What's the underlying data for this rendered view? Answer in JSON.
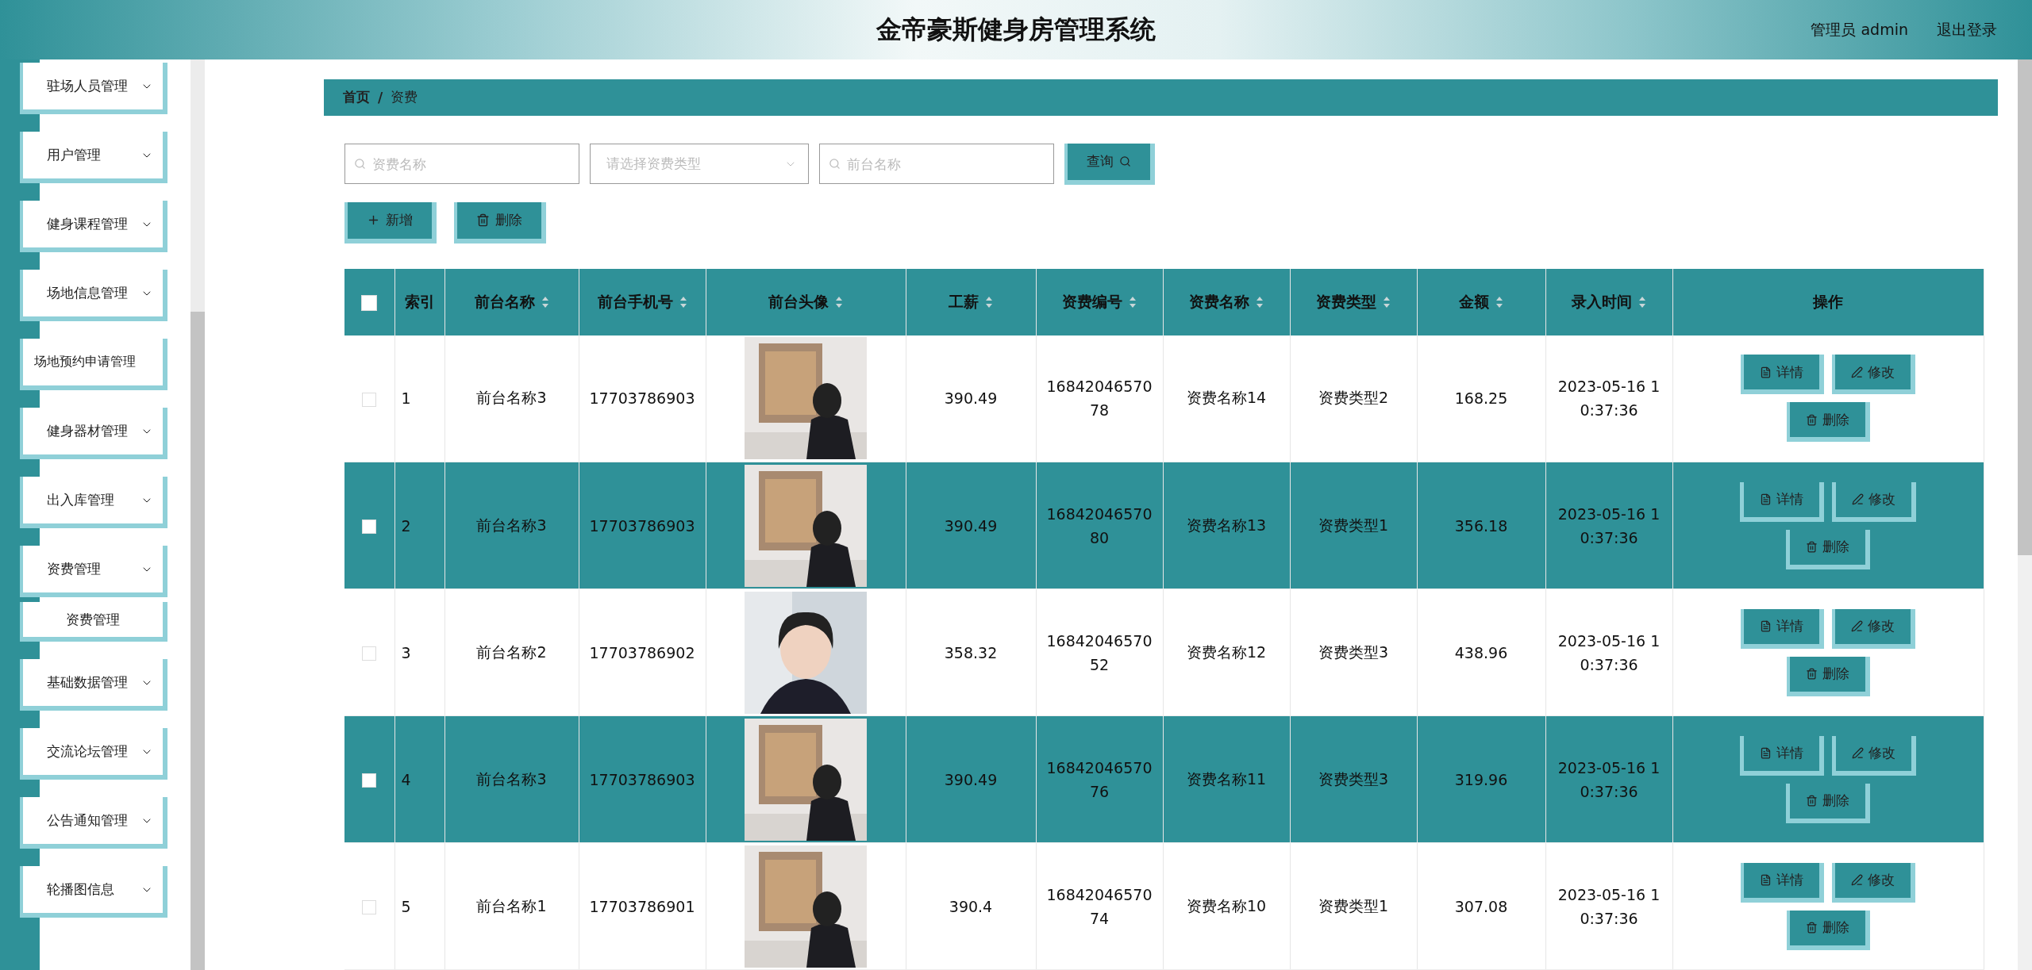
{
  "header": {
    "title": "金帝豪斯健身房管理系统",
    "user": "管理员 admin",
    "logout": "退出登录"
  },
  "sidebar": {
    "items": [
      {
        "kind": "group",
        "label": "驻场人员管理"
      },
      {
        "kind": "group",
        "label": "用户管理"
      },
      {
        "kind": "group",
        "label": "健身课程管理"
      },
      {
        "kind": "group",
        "label": "场地信息管理"
      },
      {
        "kind": "link",
        "label": "场地预约申请管理"
      },
      {
        "kind": "group",
        "label": "健身器材管理"
      },
      {
        "kind": "group",
        "label": "出入库管理"
      },
      {
        "kind": "group",
        "label": "资费管理",
        "children": [
          {
            "label": "资费管理"
          }
        ]
      },
      {
        "kind": "group",
        "label": "基础数据管理"
      },
      {
        "kind": "group",
        "label": "交流论坛管理"
      },
      {
        "kind": "group",
        "label": "公告通知管理"
      },
      {
        "kind": "group",
        "label": "轮播图信息"
      }
    ]
  },
  "breadcrumb": {
    "items": [
      "首页",
      "资费"
    ],
    "separator": "/"
  },
  "search": {
    "fields": [
      {
        "kind": "input",
        "placeholder": "资费名称"
      },
      {
        "kind": "select",
        "placeholder": "请选择资费类型"
      },
      {
        "kind": "input",
        "placeholder": "前台名称"
      }
    ],
    "button": "查询"
  },
  "actions": [
    {
      "kind": "add",
      "label": "新增"
    },
    {
      "kind": "delete",
      "label": "删除"
    }
  ],
  "table": {
    "select_all_checked": false,
    "columns": [
      {
        "label": "索引",
        "sortable": false
      },
      {
        "label": "前台名称",
        "sortable": true
      },
      {
        "label": "前台手机号",
        "sortable": true
      },
      {
        "label": "前台头像",
        "sortable": true
      },
      {
        "label": "工薪",
        "sortable": true
      },
      {
        "label": "资费编号",
        "sortable": true
      },
      {
        "label": "资费名称",
        "sortable": true
      },
      {
        "label": "资费类型",
        "sortable": true
      },
      {
        "label": "金额",
        "sortable": true
      },
      {
        "label": "录入时间",
        "sortable": true
      },
      {
        "label": "操作",
        "sortable": false
      }
    ],
    "rows": [
      {
        "checked": false,
        "index": "1",
        "name": "前台名称3",
        "phone": "17703786903",
        "salary": "390.49",
        "code": "1684204657078",
        "fee_name": "资费名称14",
        "fee_type": "资费类型2",
        "amount": "168.25",
        "time": "2023-05-16 10:37:36",
        "buttons": [
          {
            "kind": "detail",
            "label": "详情"
          },
          {
            "kind": "edit",
            "label": "修改"
          },
          {
            "kind": "delete",
            "label": "删除"
          }
        ]
      },
      {
        "checked": false,
        "index": "2",
        "name": "前台名称3",
        "phone": "17703786903",
        "salary": "390.49",
        "code": "1684204657080",
        "fee_name": "资费名称13",
        "fee_type": "资费类型1",
        "amount": "356.18",
        "time": "2023-05-16 10:37:36",
        "buttons": [
          {
            "kind": "detail",
            "label": "详情"
          },
          {
            "kind": "edit",
            "label": "修改"
          },
          {
            "kind": "delete",
            "label": "删除"
          }
        ]
      },
      {
        "checked": false,
        "index": "3",
        "name": "前台名称2",
        "phone": "17703786902",
        "salary": "358.32",
        "code": "1684204657052",
        "fee_name": "资费名称12",
        "fee_type": "资费类型3",
        "amount": "438.96",
        "time": "2023-05-16 10:37:36",
        "buttons": [
          {
            "kind": "detail",
            "label": "详情"
          },
          {
            "kind": "edit",
            "label": "修改"
          },
          {
            "kind": "delete",
            "label": "删除"
          }
        ]
      },
      {
        "checked": false,
        "index": "4",
        "name": "前台名称3",
        "phone": "17703786903",
        "salary": "390.49",
        "code": "1684204657076",
        "fee_name": "资费名称11",
        "fee_type": "资费类型3",
        "amount": "319.96",
        "time": "2023-05-16 10:37:36",
        "buttons": [
          {
            "kind": "detail",
            "label": "详情"
          },
          {
            "kind": "edit",
            "label": "修改"
          },
          {
            "kind": "delete",
            "label": "删除"
          }
        ]
      },
      {
        "checked": false,
        "index": "5",
        "name": "前台名称1",
        "phone": "17703786901",
        "salary": "390.4",
        "code": "1684204657074",
        "fee_name": "资费名称10",
        "fee_type": "资费类型1",
        "amount": "307.08",
        "time": "2023-05-16 10:37:36",
        "buttons": [
          {
            "kind": "detail",
            "label": "详情"
          },
          {
            "kind": "edit",
            "label": "修改"
          },
          {
            "kind": "delete",
            "label": "删除"
          }
        ]
      }
    ]
  }
}
